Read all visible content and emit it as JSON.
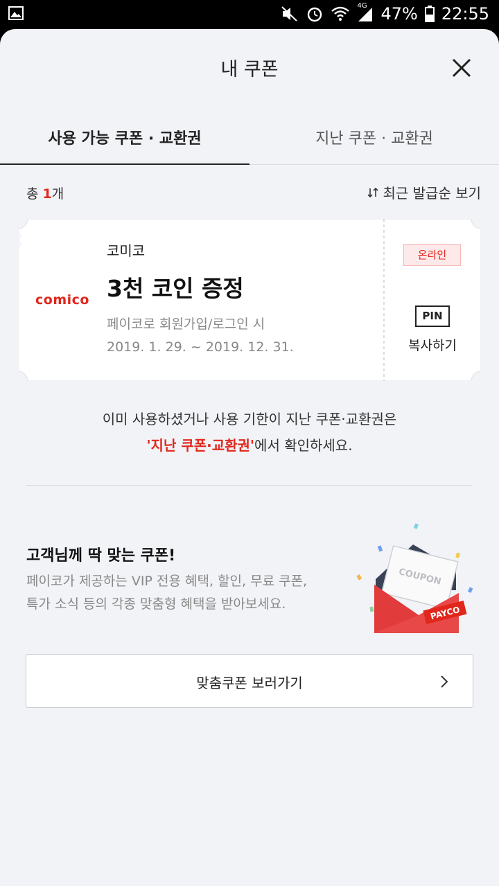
{
  "status": {
    "battery": "47%",
    "time": "22:55",
    "network": "4G"
  },
  "header": {
    "title": "내 쿠폰"
  },
  "tabs": [
    {
      "label": "사용 가능 쿠폰 · 교환권",
      "active": true
    },
    {
      "label": "지난 쿠폰 · 교환권",
      "active": false
    }
  ],
  "list": {
    "count_prefix": "총 ",
    "count": "1",
    "count_suffix": "개",
    "sort_label": "최근 발급순 보기"
  },
  "coupon": {
    "logo": "comico",
    "brand": "코미코",
    "title": "3천 코인 증정",
    "condition": "페이코로 회원가입/로그인 시",
    "period": "2019. 1. 29. ~ 2019. 12. 31.",
    "badge": "온라인",
    "pin_label": "PIN",
    "copy_label": "복사하기"
  },
  "notice": {
    "line1": "이미 사용하셨거나 사용 기한이 지난 쿠폰·교환권은",
    "line2_highlight": "'지난 쿠폰·교환권'",
    "line2_rest": "에서 확인하세요."
  },
  "recommend": {
    "title": "고객님께 딱 맞는 쿠폰!",
    "desc1": "페이코가 제공하는 VIP 전용 혜택, 할인, 무료 쿠폰,",
    "desc2": "특가 소식 등의 각종 맞춤형 혜택을 받아보세요.",
    "illustration_coupon": "COUPON",
    "illustration_brand": "PAYCO",
    "button_label": "맞춤쿠폰 보러가기"
  },
  "colors": {
    "accent": "#e1261c",
    "background": "#f2f3f7"
  }
}
